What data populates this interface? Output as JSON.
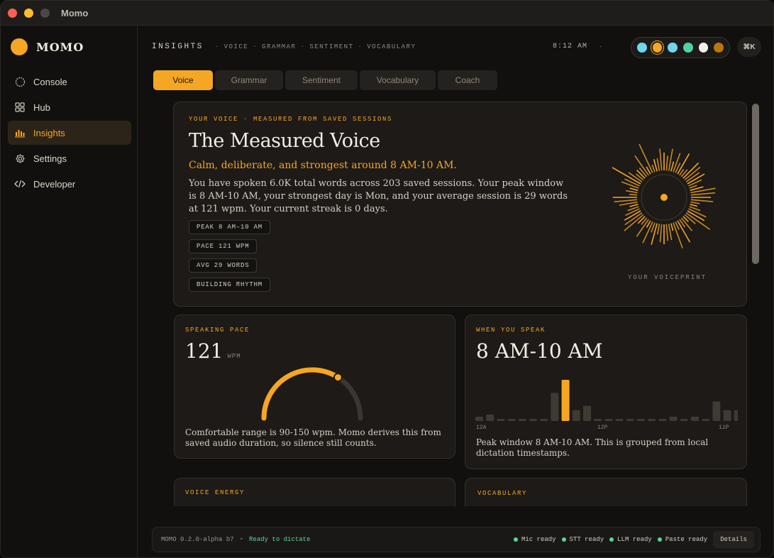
{
  "window": {
    "title": "Momo"
  },
  "sidebar": {
    "brand": "MOMO",
    "items": [
      {
        "label": "Console",
        "icon": "circle-icon",
        "active": false
      },
      {
        "label": "Hub",
        "icon": "grid-icon",
        "active": false
      },
      {
        "label": "Insights",
        "icon": "bar-chart-icon",
        "active": true
      },
      {
        "label": "Settings",
        "icon": "gear-icon",
        "active": false
      },
      {
        "label": "Developer",
        "icon": "code-icon",
        "active": false
      }
    ]
  },
  "topbar": {
    "section": "INSIGHTS",
    "crumbs": [
      "VOICE",
      "GRAMMAR",
      "SENTIMENT",
      "VOCABULARY"
    ],
    "time": "8:12 AM",
    "theme_colors": [
      "#6fd6f0",
      "#f5a623",
      "#6fd6f0",
      "#4fd1a5",
      "#f2f0ec",
      "#b8760f"
    ],
    "shortcut": "⌘K"
  },
  "tabs": [
    {
      "label": "Voice",
      "active": true
    },
    {
      "label": "Grammar",
      "active": false
    },
    {
      "label": "Sentiment",
      "active": false
    },
    {
      "label": "Vocabulary",
      "active": false
    },
    {
      "label": "Coach",
      "active": false
    }
  ],
  "hero": {
    "eyebrow": "YOUR VOICE · MEASURED FROM SAVED SESSIONS",
    "title": "The Measured Voice",
    "subtitle": "Calm, deliberate, and strongest around 8 AM-10 AM.",
    "body": "You have spoken 6.0K total words across 203 saved sessions. Your peak window is 8 AM-10 AM, your strongest day is Mon, and your average session is 29 words at 121 wpm. Your current streak is 0 days.",
    "chips": [
      "PEAK 8 AM–10 AM",
      "PACE 121 WPM",
      "AVG 29 WORDS",
      "BUILDING RHYTHM"
    ],
    "voiceprint_label": "YOUR VOICEPRINT"
  },
  "pace": {
    "eyebrow": "SPEAKING PACE",
    "value": "121",
    "unit": "WPM",
    "gauge_fraction": 0.68,
    "body": "Comfortable range is 90-150 wpm. Momo derives this from saved audio duration, so silence still counts."
  },
  "when": {
    "eyebrow": "WHEN YOU SPEAK",
    "value": "8 AM-10 AM",
    "axis": [
      "12A",
      "12P",
      "11P"
    ],
    "hours": [
      2,
      3,
      1,
      1,
      1,
      1,
      1,
      13,
      19,
      5,
      7,
      1,
      1,
      1,
      1,
      1,
      1,
      1,
      2,
      1,
      2,
      1,
      9,
      5,
      5
    ],
    "peak_index": 8,
    "body": "Peak window 8 AM-10 AM. This is grouped from local dictation timestamps."
  },
  "energy": {
    "eyebrow": "VOICE ENERGY"
  },
  "vocab": {
    "eyebrow": "VOCABULARY"
  },
  "status": {
    "version": "MOMO 0.2.0-alpha b7",
    "state": "Ready to dictate",
    "items": [
      "Mic ready",
      "STT ready",
      "LLM ready",
      "Paste ready"
    ],
    "details": "Details"
  },
  "colors": {
    "accent": "#f5a623",
    "ok": "#5fd39a"
  }
}
